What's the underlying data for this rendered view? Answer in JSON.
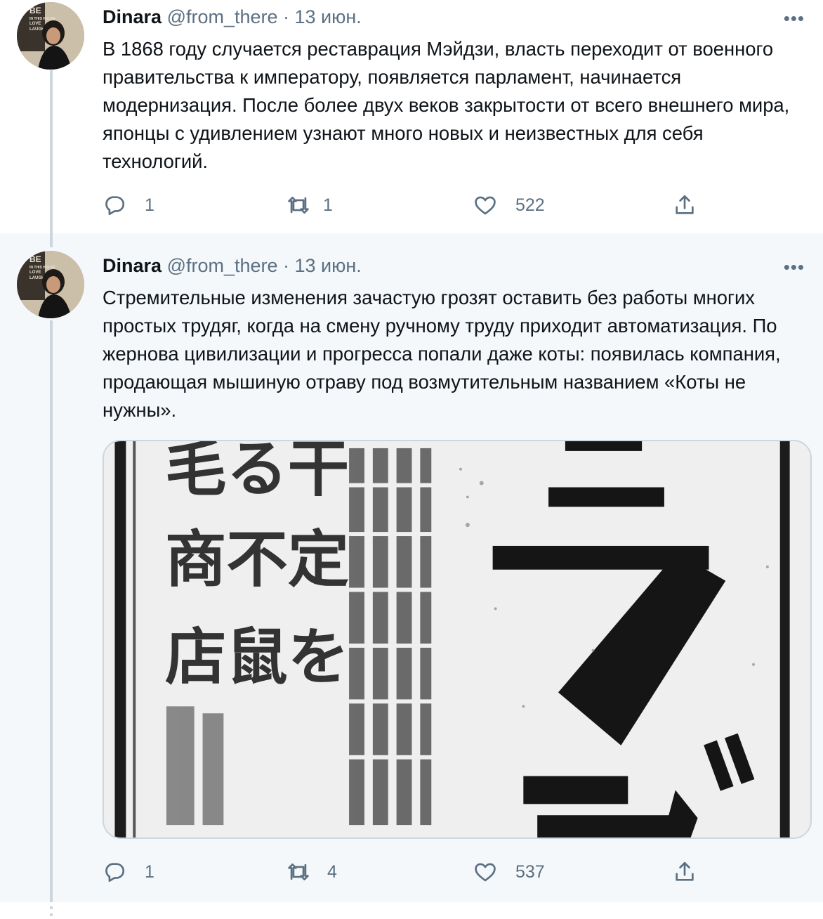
{
  "tweets": [
    {
      "name": "Dinara",
      "meta": "@from_there · 13 июн.",
      "more": "•••",
      "text": "В 1868 году случается реставрация Мэйдзи, власть переходит от военного правительства к императору, появляется парламент, начинается модернизация. После более двух веков закрытости от всего внешнего мира, японцы с удивлением узнают много новых и неизвестных для себя технологий.",
      "replies": "1",
      "retweets": "1",
      "likes": "522"
    },
    {
      "name": "Dinara",
      "meta": "@from_there · 13 июн.",
      "more": "•••",
      "text": "Стремительные изменения зачастую грозят оставить без работы многих простых трудяг, когда на смену ручному труду приходит автоматизация. По жернова цивилизации и прогресса попали даже коты: появилась компания, продающая мышиную отраву под возмутительным названием «Коты не нужны».",
      "media": {
        "glyphs_left": "毛る干",
        "glyphs_mid": "商不定",
        "glyphs_low": "店鼠を",
        "katakana": "ラヅ"
      },
      "replies": "1",
      "retweets": "4",
      "likes": "537"
    }
  ],
  "icons": {
    "reply": "reply-icon",
    "retweet": "retweet-icon",
    "like": "heart-icon",
    "share": "share-icon",
    "more": "more-icon"
  },
  "colors": {
    "text": "#0f1419",
    "secondary": "#5b7083",
    "thread_line": "#ccd6dd",
    "highlight_bg": "#f5f8fa"
  }
}
